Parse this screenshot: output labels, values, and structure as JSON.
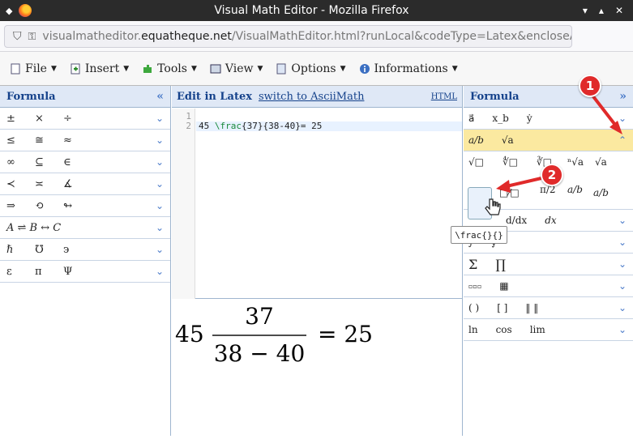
{
  "window": {
    "title": "Visual Math Editor - Mozilla Firefox"
  },
  "browser": {
    "url_prefix": "visualmatheditor.",
    "url_domain": "equatheque.net",
    "url_suffix": "/VisualMathEditor.html?runLocal&codeType=Latex&encloseAllFormula"
  },
  "toolbar": {
    "file": "File",
    "insert": "Insert",
    "tools": "Tools",
    "view": "View",
    "options": "Options",
    "informations": "Informations"
  },
  "left_panel": {
    "title": "Formula",
    "rows": [
      [
        "±",
        "×",
        "÷"
      ],
      [
        "≤",
        "≅",
        "≈"
      ],
      [
        "∞",
        "⊆",
        "∈"
      ],
      [
        "≺",
        "≍",
        "∡"
      ],
      [
        "⇒",
        "⟲",
        "↬"
      ],
      [
        "A ⇌ B ↔ C"
      ],
      [
        "ℏ",
        "℧",
        "϶"
      ],
      [
        "ε",
        "π",
        "Ψ"
      ]
    ]
  },
  "editor": {
    "title": "Edit in Latex",
    "switch_link": "switch to AsciiMath",
    "html_link": "HTML",
    "line_numbers": [
      "1",
      "2"
    ],
    "code_a": "45 ",
    "code_cmd": "\\frac",
    "code_b": "{37}{38-40}= 25",
    "preview": {
      "lhs": "45",
      "num": "37",
      "den": "38 − 40",
      "eq": "= 25"
    }
  },
  "right_panel": {
    "title": "Formula",
    "rows": [
      [
        "a⃗",
        "x_b",
        "ẏ"
      ],
      [
        "a/b",
        "√a"
      ],
      [
        "d/dx",
        "dx"
      ],
      [
        "∫",
        "∮"
      ],
      [
        "Σ",
        "∏"
      ],
      [
        "▫▫▫",
        "▦"
      ],
      [
        "( )",
        "[ ]",
        "‖ ‖"
      ],
      [
        "ln",
        "cos",
        "lim"
      ]
    ],
    "sub_row1": [
      "√□",
      "∜□",
      "∛□",
      "ⁿ√a",
      "√a"
    ],
    "sub_row2": [
      "□/□",
      "□⁄□",
      "π/2",
      "a/b",
      "a/b"
    ]
  },
  "tooltip": "\\frac{}{}",
  "annotations": {
    "step1": "1",
    "step2": "2"
  }
}
